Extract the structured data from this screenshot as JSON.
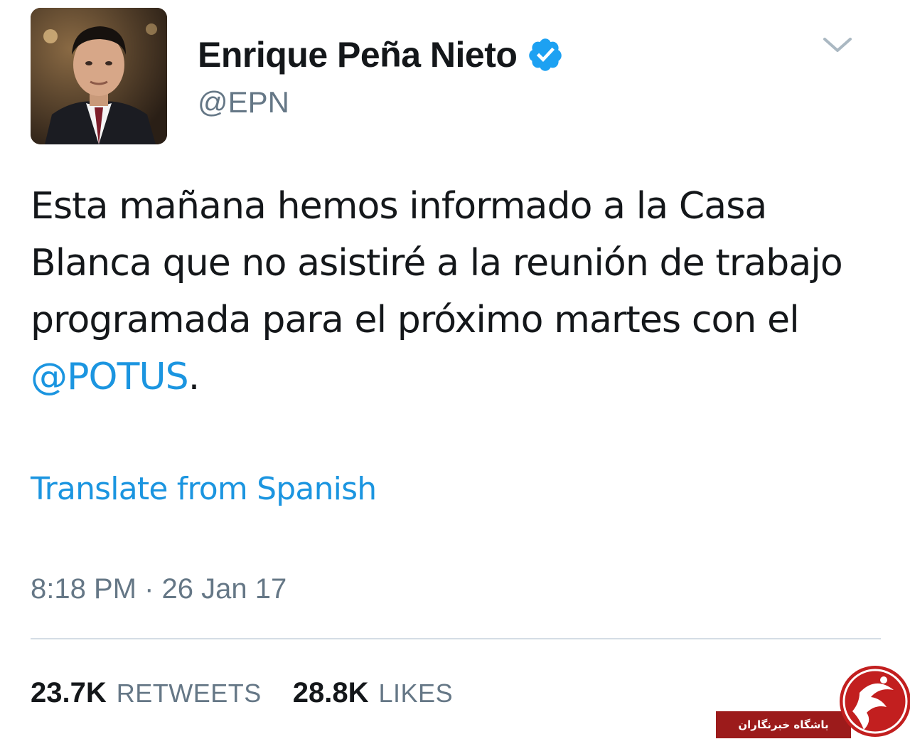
{
  "user": {
    "display_name": "Enrique Peña Nieto",
    "handle": "@EPN",
    "verified": true
  },
  "tweet": {
    "text_before_mention": "Esta mañana hemos informado a la Casa Blanca que no asistiré a la reunión de trabajo programada para el próximo martes con el ",
    "mention": "@POTUS",
    "text_after_mention": ".",
    "translate_label": "Translate from Spanish",
    "timestamp": "8:18 PM · 26 Jan 17"
  },
  "stats": {
    "retweets_count": "23.7K",
    "retweets_label": "RETWEETS",
    "likes_count": "28.8K",
    "likes_label": "LIKES"
  },
  "watermark": {
    "text": "باشگاه خبرنگاران"
  },
  "icons": {
    "verified": "verified-badge-icon",
    "menu": "chevron-down-icon"
  },
  "colors": {
    "link": "#1b95e0",
    "secondary_text": "#657786",
    "primary_text": "#14171a",
    "verified": "#1da1f2",
    "watermark_red": "#9c1b1b"
  }
}
